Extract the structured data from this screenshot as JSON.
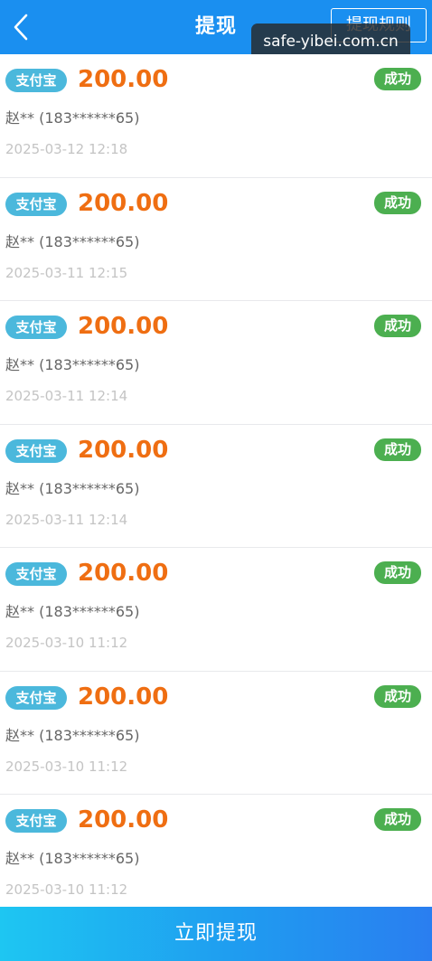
{
  "header": {
    "title": "提现",
    "rules_label": "提现规则",
    "back_icon": "chevron-left-icon"
  },
  "watermark": "safe-yibei.com.cn",
  "records": [
    {
      "method": "支付宝",
      "amount": "200.00",
      "status": "成功",
      "account": "赵** (183******65)",
      "time": "2025-03-12 12:18"
    },
    {
      "method": "支付宝",
      "amount": "200.00",
      "status": "成功",
      "account": "赵** (183******65)",
      "time": "2025-03-11 12:15"
    },
    {
      "method": "支付宝",
      "amount": "200.00",
      "status": "成功",
      "account": "赵** (183******65)",
      "time": "2025-03-11 12:14"
    },
    {
      "method": "支付宝",
      "amount": "200.00",
      "status": "成功",
      "account": "赵** (183******65)",
      "time": "2025-03-11 12:14"
    },
    {
      "method": "支付宝",
      "amount": "200.00",
      "status": "成功",
      "account": "赵** (183******65)",
      "time": "2025-03-10 11:12"
    },
    {
      "method": "支付宝",
      "amount": "200.00",
      "status": "成功",
      "account": "赵** (183******65)",
      "time": "2025-03-10 11:12"
    },
    {
      "method": "支付宝",
      "amount": "200.00",
      "status": "成功",
      "account": "赵** (183******65)",
      "time": "2025-03-10 11:12"
    }
  ],
  "footer": {
    "withdraw_label": "立即提现"
  },
  "colors": {
    "header_bg": "#1a8ff0",
    "amount": "#ef6e12",
    "method_badge": "#4bb8dc",
    "status_success": "#4caf50"
  }
}
